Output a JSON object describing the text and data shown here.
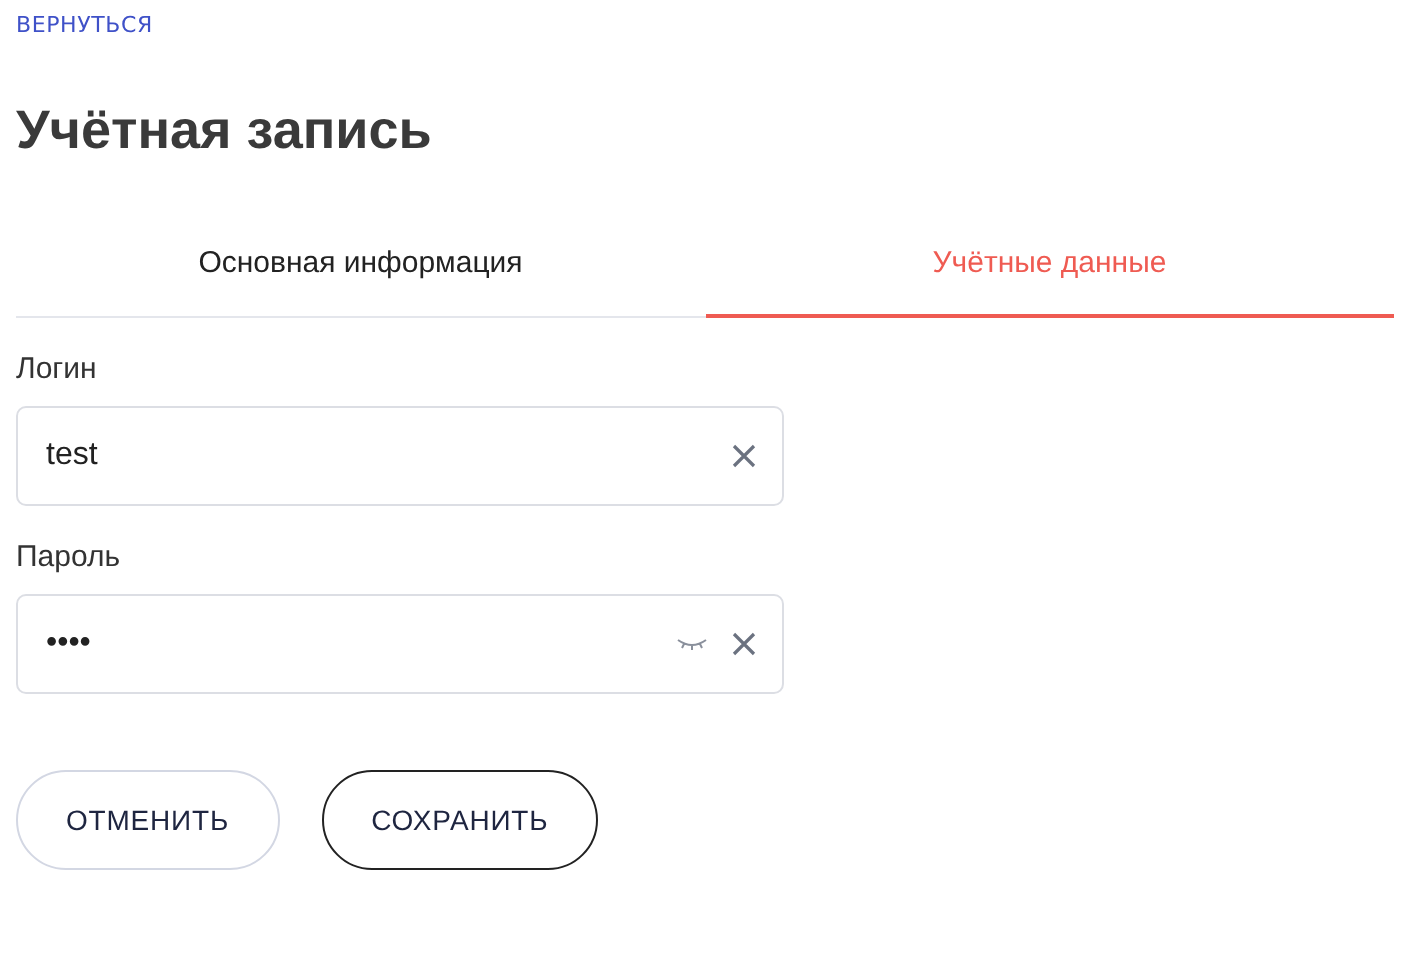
{
  "back_link": "ВЕРНУТЬСЯ",
  "title": "Учётная запись",
  "tabs": [
    {
      "label": "Основная информация",
      "selected": false
    },
    {
      "label": "Учётные данные",
      "selected": true
    }
  ],
  "fields": [
    {
      "kind": "text",
      "label": "Логин",
      "value": "test"
    },
    {
      "kind": "password",
      "label": "Пароль",
      "value": "••••"
    }
  ],
  "buttons": [
    {
      "kind": "secondary",
      "label": "ОТМЕНИТЬ"
    },
    {
      "kind": "primary",
      "label": "СОХРАНИТЬ"
    }
  ]
}
